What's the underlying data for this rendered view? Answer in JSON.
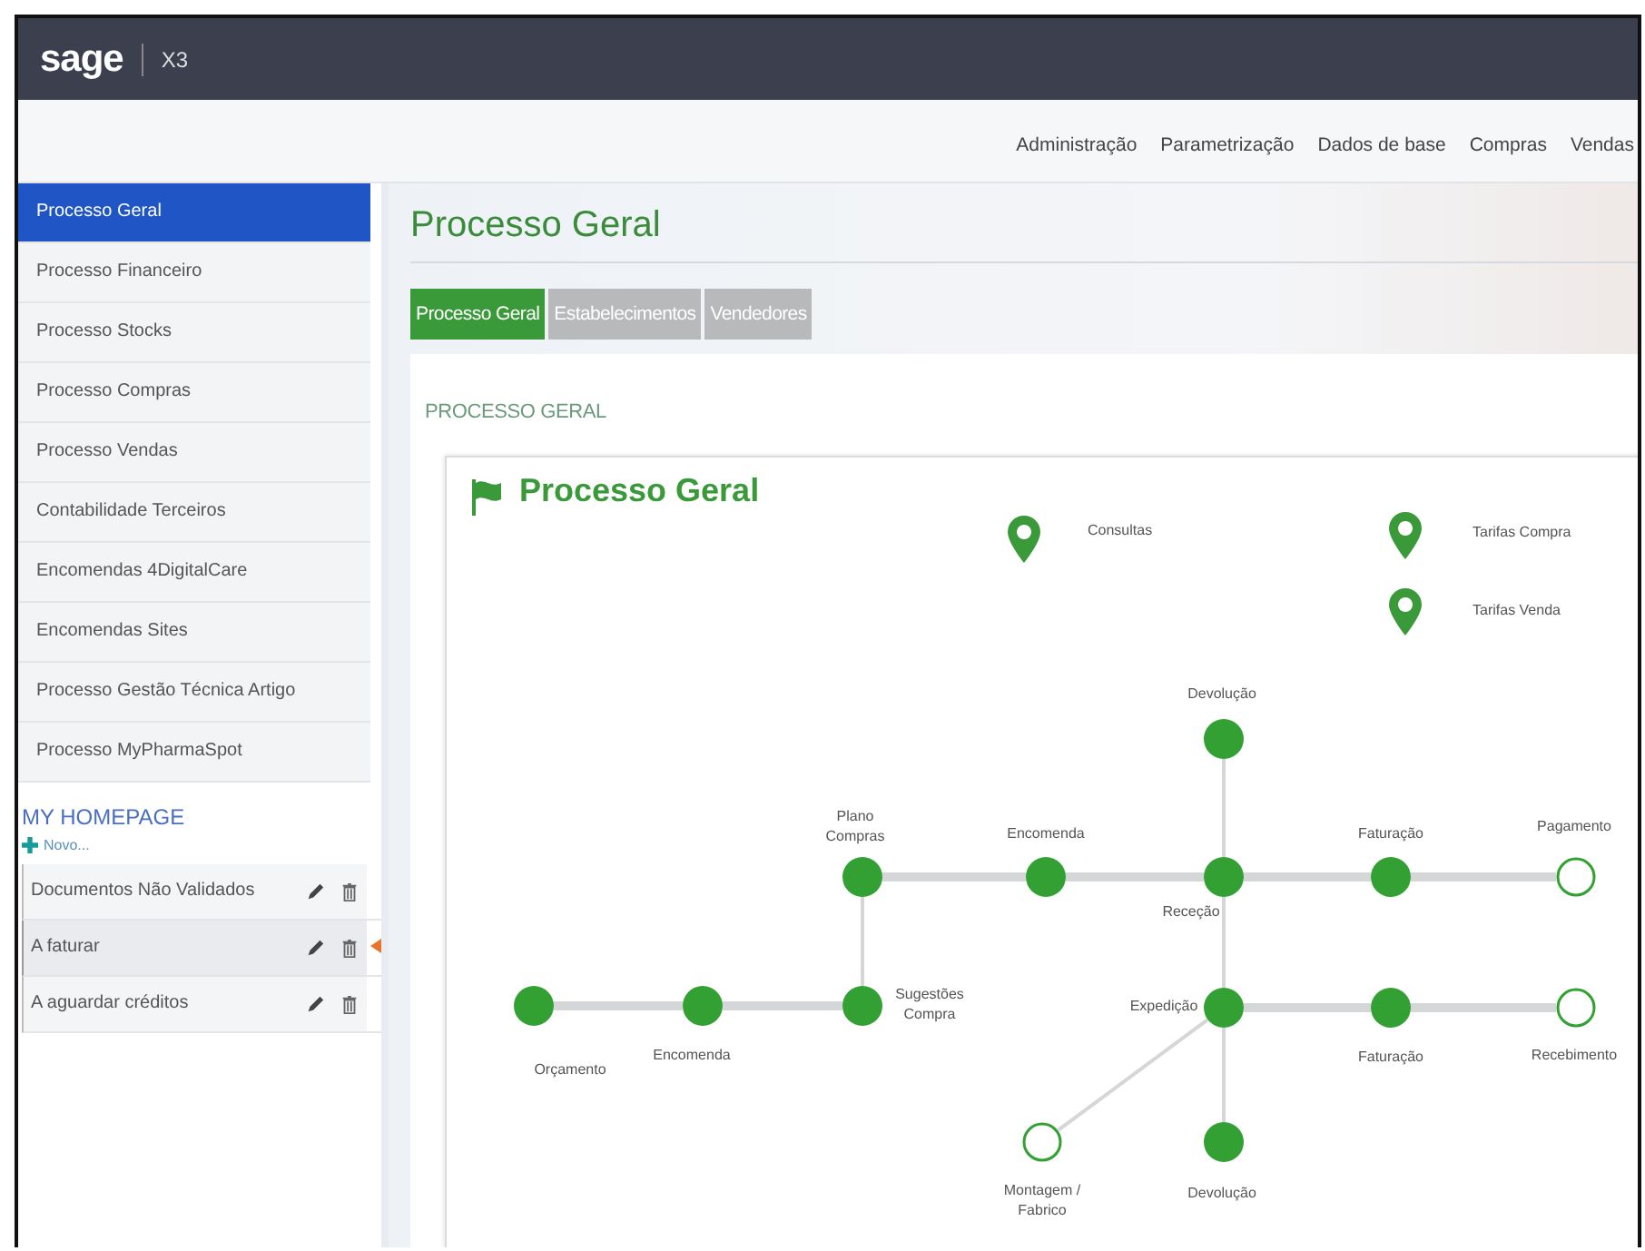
{
  "header": {
    "logo": "sage",
    "product": "X3"
  },
  "menu": [
    "Administração",
    "Parametrização",
    "Dados de base",
    "Compras",
    "Vendas"
  ],
  "sidebar": {
    "items": [
      {
        "label": "Processo Geral",
        "selected": true
      },
      {
        "label": "Processo Financeiro",
        "selected": false
      },
      {
        "label": "Processo Stocks",
        "selected": false
      },
      {
        "label": "Processo Compras",
        "selected": false
      },
      {
        "label": "Processo Vendas",
        "selected": false
      },
      {
        "label": "Contabilidade Terceiros",
        "selected": false
      },
      {
        "label": "Encomendas 4DigitalCare",
        "selected": false
      },
      {
        "label": "Encomendas Sites",
        "selected": false
      },
      {
        "label": "Processo Gestão Técnica Artigo",
        "selected": false
      },
      {
        "label": "Processo MyPharmaSpot",
        "selected": false
      }
    ]
  },
  "homepage": {
    "title": "MY HOMEPAGE",
    "new_link": "Novo...",
    "items": [
      {
        "label": "Documentos Não Validados",
        "current": false
      },
      {
        "label": "A faturar",
        "current": true
      },
      {
        "label": "A aguardar créditos",
        "current": false
      }
    ]
  },
  "page_title": "Processo Geral",
  "tabs": [
    {
      "label": "Processo Geral",
      "selected": true
    },
    {
      "label": "Estabelecimentos",
      "selected": false
    },
    {
      "label": "Vendedores",
      "selected": false
    }
  ],
  "section_title": "PROCESSO GERAL",
  "diagram": {
    "title": "Processo Geral",
    "shortcuts": [
      {
        "label": "Consultas"
      },
      {
        "label": "Tarifas Compra"
      },
      {
        "label": "Tarifas Venda"
      }
    ],
    "nodes": [
      {
        "label": "Devolução",
        "filled": true
      },
      {
        "label": "Plano Compras",
        "filled": true
      },
      {
        "label": "Encomenda",
        "filled": true
      },
      {
        "label": "Receção",
        "filled": true
      },
      {
        "label": "Faturação",
        "filled": true
      },
      {
        "label": "Pagamento",
        "filled": false
      },
      {
        "label": "Orçamento",
        "filled": true
      },
      {
        "label": "Encomenda",
        "filled": true
      },
      {
        "label": "Sugestões Compra",
        "filled": true
      },
      {
        "label": "Expedição",
        "filled": true
      },
      {
        "label": "Faturação",
        "filled": true
      },
      {
        "label": "Recebimento",
        "filled": false
      },
      {
        "label": "Montagem / Fabrico",
        "filled": false
      },
      {
        "label": "Devolução",
        "filled": true
      }
    ]
  }
}
